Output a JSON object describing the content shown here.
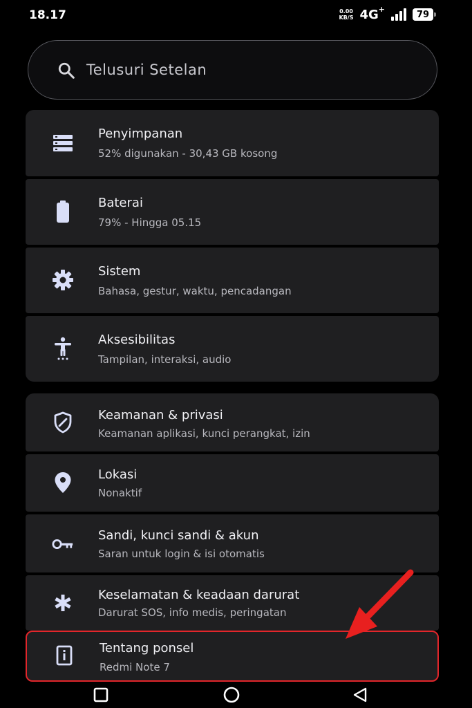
{
  "status_bar": {
    "time": "18.17",
    "net_speed_value": "0.00",
    "net_speed_unit": "KB/S",
    "network_type": "4G",
    "network_type_sup": "+",
    "battery_level": "79"
  },
  "search": {
    "placeholder": "Telusuri Setelan",
    "icon": "search-icon"
  },
  "settings": {
    "items": [
      {
        "icon": "storage-icon",
        "title": "Penyimpanan",
        "subtitle": "52% digunakan - 30,43 GB kosong"
      },
      {
        "icon": "battery-icon",
        "title": "Baterai",
        "subtitle": "79% - Hingga 05.15"
      },
      {
        "icon": "gear-icon",
        "title": "Sistem",
        "subtitle": "Bahasa, gestur, waktu, pencadangan"
      },
      {
        "icon": "accessibility-icon",
        "title": "Aksesibilitas",
        "subtitle": "Tampilan, interaksi, audio"
      },
      {
        "icon": "shield-icon",
        "title": "Keamanan & privasi",
        "subtitle": "Keamanan aplikasi, kunci perangkat, izin"
      },
      {
        "icon": "location-pin-icon",
        "title": "Lokasi",
        "subtitle": "Nonaktif"
      },
      {
        "icon": "key-icon",
        "title": "Sandi, kunci sandi & akun",
        "subtitle": "Saran untuk login & isi otomatis"
      },
      {
        "icon": "asterisk-icon",
        "title": "Keselamatan & keadaan darurat",
        "subtitle": "Darurat SOS, info medis, peringatan"
      },
      {
        "icon": "info-icon",
        "title": "Tentang ponsel",
        "subtitle": "Redmi Note 7"
      }
    ]
  },
  "nav_bar": {
    "buttons": [
      "recents-square-icon",
      "home-circle-icon",
      "back-triangle-icon"
    ]
  },
  "colors": {
    "background": "#000000",
    "card": "#1f1f21",
    "icon": "#d9def8",
    "highlight": "#e3262b",
    "arrow": "#e8201f"
  }
}
